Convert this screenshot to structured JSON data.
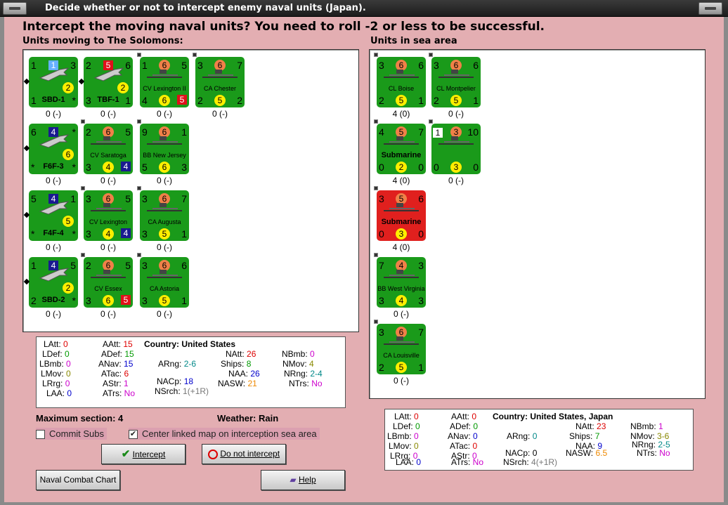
{
  "window": {
    "title": "Decide whether or not to intercept enemy naval units (Japan)."
  },
  "heading": "Intercept the moving naval units?  You need to roll -2 or less to be successful.",
  "left_label": "Units moving to The Solomons:",
  "right_label": "Units in sea area",
  "left_units": [
    {
      "tl": "1",
      "tc": "1",
      "tcs": "lblue",
      "tr": "3",
      "bl": "1",
      "bc": "2",
      "br": "*",
      "name": "SBD-1",
      "big": true,
      "air": true,
      "stack": "0 (-)"
    },
    {
      "tl": "2",
      "tc": "5",
      "tcs": "red",
      "tr": "6",
      "bl": "3",
      "bc": "2",
      "br": "1",
      "name": "TBF-1",
      "big": true,
      "air": true,
      "stack": "0 (-)"
    },
    {
      "tl": "1",
      "tc": "6",
      "tr": "5",
      "bl": "4",
      "bc": "6",
      "br": "5",
      "brs": "red",
      "name": "CV Lexington II",
      "stack": "0 (-)"
    },
    {
      "tl": "3",
      "tc": "6",
      "tr": "7",
      "bl": "2",
      "bc": "5",
      "br": "2",
      "name": "CA Chester",
      "stack": "0 (-)"
    },
    {
      "tl": "6",
      "tc": "4",
      "tcs": "blue",
      "tr": "*",
      "bl": "*",
      "bc": "6",
      "br": "*",
      "name": "F6F-3",
      "big": true,
      "air": true,
      "stack": "0 (-)"
    },
    {
      "tl": "2",
      "tc": "6",
      "tr": "5",
      "bl": "3",
      "bc": "4",
      "br": "4",
      "brs": "blue",
      "name": "CV Saratoga",
      "stack": "0 (-)"
    },
    {
      "tl": "9",
      "tc": "6",
      "tr": "1",
      "bl": "5",
      "bc": "6",
      "br": "3",
      "name": "BB New Jersey",
      "stack": "0 (-)"
    },
    {
      "tl": "5",
      "tc": "4",
      "tcs": "blue",
      "tr": "1",
      "bl": "*",
      "bc": "5",
      "br": "*",
      "name": "F4F-4",
      "big": true,
      "air": true,
      "stack": "0 (-)"
    },
    {
      "tl": "3",
      "tc": "6",
      "tr": "5",
      "bl": "3",
      "bc": "4",
      "br": "4",
      "brs": "blue",
      "name": "CV Lexington",
      "stack": "0 (-)"
    },
    {
      "tl": "3",
      "tc": "6",
      "tr": "7",
      "bl": "3",
      "bc": "5",
      "br": "1",
      "name": "CA Augusta",
      "stack": "0 (-)"
    },
    {
      "tl": "1",
      "tc": "4",
      "tcs": "blue",
      "tr": "5",
      "bl": "2",
      "bc": "2",
      "br": "*",
      "name": "SBD-2",
      "big": true,
      "air": true,
      "stack": "0 (-)"
    },
    {
      "tl": "2",
      "tc": "6",
      "tr": "5",
      "bl": "3",
      "bc": "6",
      "br": "5",
      "brs": "red",
      "name": "CV Essex",
      "stack": "0 (-)"
    },
    {
      "tl": "3",
      "tc": "6",
      "tr": "6",
      "bl": "3",
      "bc": "5",
      "br": "1",
      "name": "CA Astoria",
      "stack": "0 (-)"
    }
  ],
  "right_units": [
    {
      "tl": "3",
      "tc": "6",
      "tr": "6",
      "bl": "2",
      "bc": "5",
      "br": "1",
      "name": "CL Boise",
      "stack": "4 (0)"
    },
    {
      "tl": "3",
      "tc": "6",
      "tr": "6",
      "bl": "2",
      "bc": "5",
      "br": "1",
      "name": "CL Montpelier",
      "stack": "0 (-)"
    },
    {
      "tl": "4",
      "tc": "5",
      "tr": "7",
      "bl": "0",
      "bc": "2",
      "br": "0",
      "name": "Submarine",
      "big": true,
      "stack": "4 (0)"
    },
    {
      "tl": "1",
      "tls": "white",
      "tc": "3",
      "tr": "10",
      "bl": "0",
      "bc": "3",
      "br": "0",
      "name": "",
      "stack": "0 (-)"
    },
    {
      "tl": "3",
      "tc": "5",
      "tr": "6",
      "bl": "0",
      "bc": "3",
      "br": "0",
      "name": "Submarine",
      "big": true,
      "red": true,
      "stack": "4 (0)"
    },
    {
      "tl": "7",
      "tc": "4",
      "tr": "3",
      "bl": "3",
      "bc": "4",
      "br": "3",
      "name": "BB West Virginia",
      "stack": "0 (-)"
    },
    {
      "tl": "3",
      "tc": "6",
      "tr": "7",
      "bl": "2",
      "bc": "5",
      "br": "1",
      "name": "CA Louisville",
      "stack": "0 (-)"
    }
  ],
  "left_stats": {
    "LAtt": "0",
    "LDef": "0",
    "LBmb": "0",
    "LMov": "0",
    "LRrg": "0",
    "LAA": "0",
    "AAtt": "15",
    "ADef": "15",
    "ANav": "15",
    "ATac": "6",
    "AStr": "1",
    "ATrs": "No",
    "country_label": "Country:",
    "country": "United States",
    "ARng": "2-6",
    "NACp": "18",
    "NSrch": "1(+1R)",
    "NAtt": "26",
    "Ships": "8",
    "NAA": "26",
    "NASW": "21",
    "NBmb": "0",
    "NMov": "4",
    "NRng": "2-4",
    "NTrs": "No"
  },
  "right_stats": {
    "LAtt": "0",
    "LDef": "0",
    "LBmb": "0",
    "LMov": "0",
    "LRrg": "0",
    "LAA": "0",
    "AAtt": "0",
    "ADef": "0",
    "ANav": "0",
    "ATac": "0",
    "AStr": "0",
    "ATrs": "No",
    "country_label": "Country:",
    "country": "United States, Japan",
    "ARng": "0",
    "NACp": "0",
    "NSrch": "4(+1R)",
    "NAtt": "23",
    "Ships": "7",
    "NAA": "9",
    "NASW": "6.5",
    "NBmb": "1",
    "NMov": "3-6",
    "NRng": "2-5",
    "NTrs": "No"
  },
  "max_section_label": "Maximum section:",
  "max_section": "4",
  "weather_label": "Weather:",
  "weather": "Rain",
  "commit_subs": "Commit Subs",
  "center_map": "Center linked map on interception sea area",
  "intercept_btn": "Intercept",
  "no_intercept_btn": "Do not intercept",
  "combat_chart_btn": "Naval Combat Chart",
  "help_btn": "Help",
  "colors": {
    "counter_green": "#1a9a1a",
    "counter_red": "#e0201e",
    "bg": "#e3aeb2"
  }
}
